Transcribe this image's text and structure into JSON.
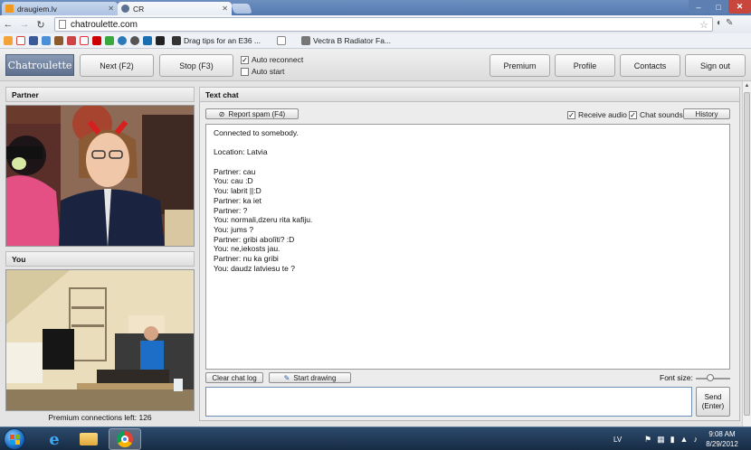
{
  "browser": {
    "tabs": [
      {
        "title": "draugiem.lv",
        "favicon_color": "#f29a1f"
      },
      {
        "title": "CR",
        "favicon_color": "#5b6f8f"
      }
    ],
    "window_controls": {
      "minimize": "–",
      "maximize": "□",
      "close": "✕"
    },
    "url": "chatroulette.com",
    "bookmarks": [
      {
        "icon": "gmail-icon",
        "color": "#d44638",
        "glyph": "M"
      },
      {
        "icon": "facebook-icon",
        "color": "#3b5998",
        "glyph": "f"
      },
      {
        "icon": "ebay-icon",
        "color": "#e53238",
        "glyph": "eBY"
      },
      {
        "icon": "youtube-icon",
        "color": "#cc0000",
        "glyph": "▶"
      },
      {
        "icon": "evernote-icon",
        "color": "#39a83d",
        "glyph": "S"
      }
    ],
    "bookmark_links": [
      {
        "label": "Drag tips for an E36 ...",
        "color": "#333333"
      },
      {
        "label": "Vectra B Radiator Fa...",
        "color": "#555555"
      }
    ]
  },
  "app": {
    "logo": "Chatroulette",
    "next_button": "Next (F2)",
    "stop_button": "Stop (F3)",
    "auto_reconnect": {
      "label": "Auto reconnect",
      "checked": true
    },
    "auto_start": {
      "label": "Auto start",
      "checked": false
    },
    "premium_button": "Premium",
    "profile_button": "Profile",
    "contacts_button": "Contacts",
    "signout_button": "Sign out",
    "partner_label": "Partner",
    "you_label": "You",
    "premium_connections": "Premium connections left: 126"
  },
  "textchat": {
    "header": "Text chat",
    "report_spam": "Report spam (F4)",
    "receive_audio": {
      "label": "Receive audio",
      "checked": true
    },
    "chat_sounds": {
      "label": "Chat sounds",
      "checked": true
    },
    "history_button": "History",
    "messages": [
      "Connected to somebody.",
      "",
      "Location: Latvia",
      "",
      "Partner: cau",
      "You: cau :D",
      "You: labrit ||:D",
      "Partner: ka iet",
      "Partner: ?",
      "You: normali,dzeru rita kafiju.",
      "You: jums ?",
      "Partner: gribi abolīti? :D",
      "You: ne,iekosts jau.",
      "Partner: nu ka gribi",
      "You: daudz latviesu te ?"
    ],
    "clear_log": "Clear chat log",
    "start_drawing": "Start drawing",
    "font_size_label": "Font size:",
    "message_value": "",
    "send_line1": "Send",
    "send_line2": "(Enter)"
  },
  "taskbar": {
    "language": "LV",
    "time": "9:08 AM",
    "date": "8/29/2012"
  }
}
